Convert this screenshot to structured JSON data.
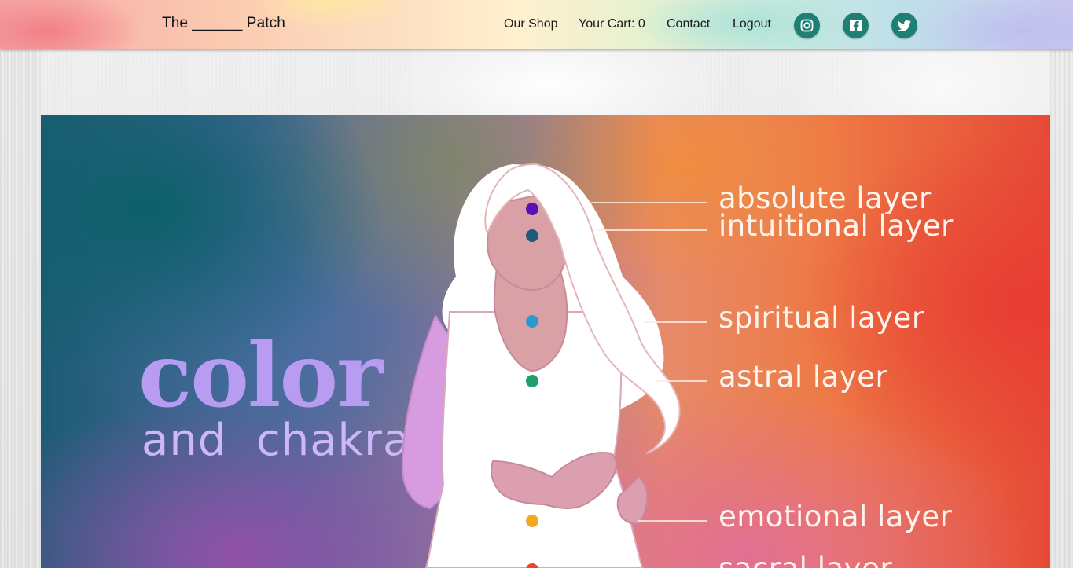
{
  "header": {
    "brand": "The ______ Patch",
    "nav": {
      "shop": "Our Shop",
      "cart": "Your Cart: 0",
      "contact": "Contact",
      "logout": "Logout"
    },
    "social": [
      "instagram-icon",
      "facebook-icon",
      "twitter-icon"
    ],
    "social_color": "#1e7f72"
  },
  "hero": {
    "title": "color",
    "subtitle": "and  chakra",
    "layers": {
      "absolute": "absolute layer",
      "intuitional": "intuitional layer",
      "spiritual": "spiritual layer",
      "astral": "astral layer",
      "emotional": "emotional layer",
      "sacral": "sacral layer"
    },
    "chakra_colors": [
      "#5a0fb4",
      "#1c5a7a",
      "#2a9ad0",
      "#1fa06a",
      "#f5a623",
      "#e8452e"
    ]
  }
}
